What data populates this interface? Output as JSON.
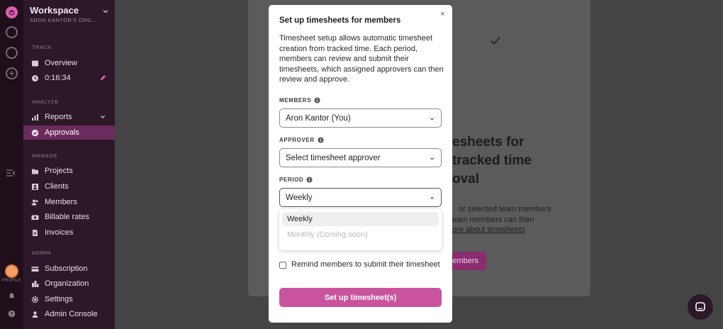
{
  "sidebar": {
    "workspace_title": "Workspace",
    "workspace_sub": "ARON KANTOR'S ORG...",
    "sections": {
      "track": "TRACK",
      "analyze": "ANALYZE",
      "manage": "MANAGE",
      "admin": "ADMIN"
    },
    "items": {
      "overview": "Overview",
      "timer": "0:16:34",
      "reports": "Reports",
      "approvals": "Approvals",
      "projects": "Projects",
      "clients": "Clients",
      "members": "Members",
      "billable_rates": "Billable rates",
      "invoices": "Invoices",
      "subscription": "Subscription",
      "organization": "Organization",
      "settings": "Settings",
      "admin_console": "Admin Console"
    },
    "profile_label": "PROFILE"
  },
  "background": {
    "heading_line1": "esheets for",
    "heading_line2": "tracked time",
    "heading_line3": "oval",
    "text_line1": "or selected team members",
    "text_line2": "eam members can then",
    "link": "ore about timesheets",
    "button": "embers"
  },
  "modal": {
    "title": "Set up timesheets for members",
    "description": "Timesheet setup allows automatic timesheet creation from tracked time. Each period, members can review and submit their timesheets, which assigned approvers can then review and approve.",
    "members_label": "MEMBERS",
    "members_value": "Aron Kantor (You)",
    "approver_label": "APPROVER",
    "approver_value": "Select timesheet approver",
    "period_label": "PERIOD",
    "period_value": "Weekly",
    "period_options": [
      {
        "label": "Weekly",
        "selected": true
      },
      {
        "label": "Monthly (Coming soon)",
        "disabled": true
      }
    ],
    "remind_label": "Remind members to submit their timesheet",
    "submit_label": "Set up timesheet(s)"
  },
  "colors": {
    "accent": "#c9549d",
    "sidebar_bg": "#2c1829",
    "active_item": "#6a2c5c"
  }
}
